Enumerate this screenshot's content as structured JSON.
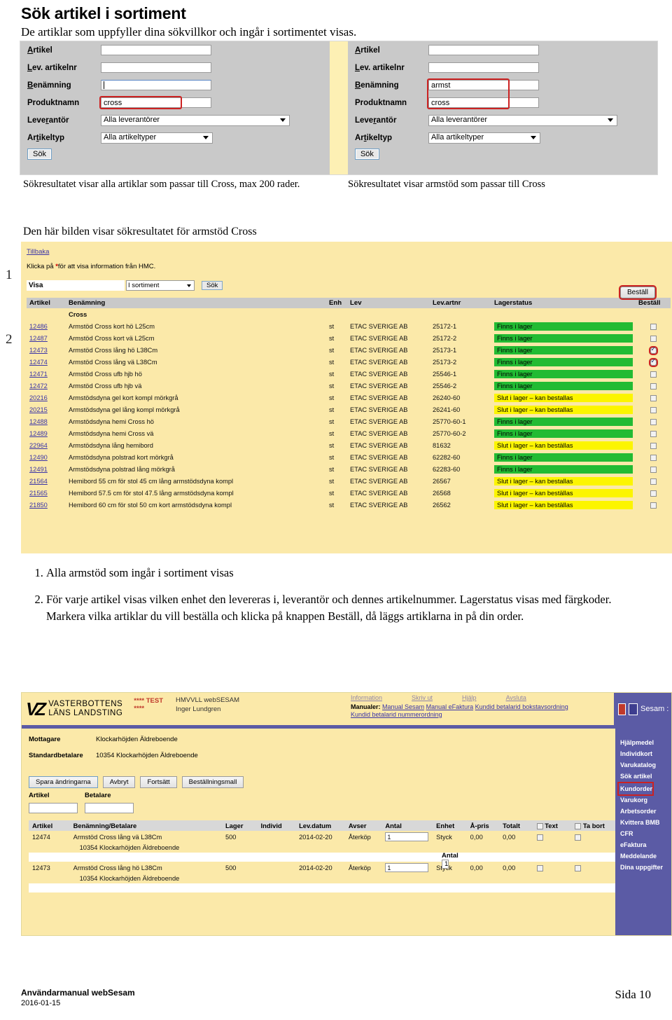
{
  "doc": {
    "title": "Sök artikel i sortiment",
    "subtitle": "De artiklar som uppfyller dina sökvillkor och ingår i sortimentet visas.",
    "intro2": "Den här bilden visar sökresultatet för armstöd Cross",
    "caption_left": "Sökresultatet visar alla artiklar som passar till Cross, max 200 rader.",
    "caption_right": "Sökresultatet visar armstöd som passar till Cross",
    "marker1": "1",
    "marker2": "2"
  },
  "search_form": {
    "labels": {
      "artikel": "Artikel",
      "lev_artikelnr": "Lev. artikelnr",
      "benamning": "Benämning",
      "produktnamn": "Produktnamn",
      "leverantor": "Leverantör",
      "artikeltyp": "Artikeltyp"
    },
    "search_button": "Sök",
    "left": {
      "artikel": "",
      "lev_artikelnr": "",
      "benamning": "",
      "produktnamn": "cross",
      "leverantor": "Alla leverantörer",
      "artikeltyp": "Alla artikeltyper"
    },
    "right": {
      "artikel": "",
      "lev_artikelnr": "",
      "benamning": "armst",
      "produktnamn": "cross",
      "leverantor": "Alla leverantörer",
      "artikeltyp": "Alla artikeltyper"
    }
  },
  "result_screen": {
    "back_link": "Tillbaka",
    "hint_before": "Klicka på ",
    "hint_star": "*",
    "hint_after": "för att visa information från HMC.",
    "visa_label": "Visa",
    "visa_value": "I sortiment",
    "search_button": "Sök",
    "order_button": "Beställ",
    "columns": [
      "Artikel",
      "Benämning",
      "Enh",
      "Lev",
      "Lev.artnr",
      "Lagerstatus",
      "Beställ"
    ],
    "group_label": "Cross",
    "status_colors": {
      "in_stock": "#22bb33",
      "out_of_stock": "#fcf500"
    },
    "rows": [
      {
        "artikel": "12486",
        "benamning": "Armstöd Cross kort hö L25cm",
        "enh": "st",
        "lev": "ETAC SVERIGE AB",
        "levartnr": "25172-1",
        "status": "Finns i lager",
        "status_type": "in_stock",
        "checked": false,
        "highlight": false
      },
      {
        "artikel": "12487",
        "benamning": "Armstöd Cross kort vä L25cm",
        "enh": "st",
        "lev": "ETAC SVERIGE AB",
        "levartnr": "25172-2",
        "status": "Finns i lager",
        "status_type": "in_stock",
        "checked": false,
        "highlight": false
      },
      {
        "artikel": "12473",
        "benamning": "Armstöd Cross lång hö L38Cm",
        "enh": "st",
        "lev": "ETAC SVERIGE AB",
        "levartnr": "25173-1",
        "status": "Finns i lager",
        "status_type": "in_stock",
        "checked": true,
        "highlight": true
      },
      {
        "artikel": "12474",
        "benamning": "Armstöd Cross lång vä L38Cm",
        "enh": "st",
        "lev": "ETAC SVERIGE AB",
        "levartnr": "25173-2",
        "status": "Finns i lager",
        "status_type": "in_stock",
        "checked": true,
        "highlight": true
      },
      {
        "artikel": "12471",
        "benamning": "Armstöd Cross ufb hjb hö",
        "enh": "st",
        "lev": "ETAC SVERIGE AB",
        "levartnr": "25546-1",
        "status": "Finns i lager",
        "status_type": "in_stock",
        "checked": false,
        "highlight": false
      },
      {
        "artikel": "12472",
        "benamning": "Armstöd Cross ufb hjb vä",
        "enh": "st",
        "lev": "ETAC SVERIGE AB",
        "levartnr": "25546-2",
        "status": "Finns i lager",
        "status_type": "in_stock",
        "checked": false,
        "highlight": false
      },
      {
        "artikel": "20216",
        "benamning": "Armstödsdyna gel kort kompl mörkgrå",
        "enh": "st",
        "lev": "ETAC SVERIGE AB",
        "levartnr": "26240-60",
        "status": "Slut i lager – kan bestallas",
        "status_type": "out_of_stock",
        "checked": false,
        "highlight": false
      },
      {
        "artikel": "20215",
        "benamning": "Armstödsdyna gel lång kompl mörkgrå",
        "enh": "st",
        "lev": "ETAC SVERIGE AB",
        "levartnr": "26241-60",
        "status": "Slut i lager – kan bestallas",
        "status_type": "out_of_stock",
        "checked": false,
        "highlight": false
      },
      {
        "artikel": "12488",
        "benamning": "Armstödsdyna hemi Cross hö",
        "enh": "st",
        "lev": "ETAC SVERIGE AB",
        "levartnr": "25770-60-1",
        "status": "Finns i lager",
        "status_type": "in_stock",
        "checked": false,
        "highlight": false
      },
      {
        "artikel": "12489",
        "benamning": "Armstödsdyna hemi Cross vä",
        "enh": "st",
        "lev": "ETAC SVERIGE AB",
        "levartnr": "25770-60-2",
        "status": "Finns i lager",
        "status_type": "in_stock",
        "checked": false,
        "highlight": false
      },
      {
        "artikel": "22964",
        "benamning": "Armstödsdyna lång hemibord",
        "enh": "st",
        "lev": "ETAC SVERIGE AB",
        "levartnr": "81632",
        "status": "Slut i lager – kan beställas",
        "status_type": "out_of_stock",
        "checked": false,
        "highlight": false
      },
      {
        "artikel": "12490",
        "benamning": "Armstödsdyna polstrad kort mörkgrå",
        "enh": "st",
        "lev": "ETAC SVERIGE AB",
        "levartnr": "62282-60",
        "status": "Finns i lager",
        "status_type": "in_stock",
        "checked": false,
        "highlight": false
      },
      {
        "artikel": "12491",
        "benamning": "Armstödsdyna polstrad lång mörkgrå",
        "enh": "st",
        "lev": "ETAC SVERIGE AB",
        "levartnr": "62283-60",
        "status": "Finns i lager",
        "status_type": "in_stock",
        "checked": false,
        "highlight": false
      },
      {
        "artikel": "21564",
        "benamning": "Hemibord 55 cm för stol 45 cm lång armstödsdyna kompl",
        "enh": "st",
        "lev": "ETAC SVERIGE AB",
        "levartnr": "26567",
        "status": "Slut i lager – kan bestallas",
        "status_type": "out_of_stock",
        "checked": false,
        "highlight": false
      },
      {
        "artikel": "21565",
        "benamning": "Hemibord 57.5 cm för stol 47.5 lång armstödsdyna kompl",
        "enh": "st",
        "lev": "ETAC SVERIGE AB",
        "levartnr": "26568",
        "status": "Slut i lager – kan beställas",
        "status_type": "out_of_stock",
        "checked": false,
        "highlight": false
      },
      {
        "artikel": "21850",
        "benamning": "Hemibord 60 cm för stol 50 cm kort armstödsdyna kompl",
        "enh": "st",
        "lev": "ETAC SVERIGE AB",
        "levartnr": "26562",
        "status": "Slut i lager – kan beställas",
        "status_type": "out_of_stock",
        "checked": false,
        "highlight": false
      }
    ]
  },
  "steps": [
    "Alla armstöd som ingår i sortiment visas",
    "För varje artikel visas vilken enhet den levereras i, leverantör och dennes artikelnummer. Lagerstatus visas med färgkoder. Markera vilka artiklar du vill beställa och klicka på knappen Beställ, då läggs artiklarna in på din order."
  ],
  "order_screen": {
    "logo_line1": "VASTERBOTTENS",
    "logo_line2": "LÄNS LANDSTING",
    "test_line1": "**** TEST",
    "test_line2": "****",
    "app_name": "HMVVLL webSESAM",
    "user": "Inger Lundgren",
    "top_links": [
      "Information",
      "Skriv ut",
      "Hjälp",
      "Avsluta"
    ],
    "manual_label": "Manualer:",
    "manual_links": [
      "Manual Sesam",
      "Manual eFaktura",
      "Kundid betalarid bokstavsordning",
      "Kundid betalarid nummerordning"
    ],
    "sesam_label": "Sesam :",
    "mottagare_label": "Mottagare",
    "mottagare_value": "Klockarhöjden Äldreboende",
    "standardbetalare_label": "Standardbetalare",
    "standardbetalare_value": "10354 Klockarhöjden Äldreboende",
    "buttons": [
      "Spara ändringarna",
      "Avbryt",
      "Fortsätt",
      "Beställningsmall"
    ],
    "artikel_label": "Artikel",
    "artikel_value": "",
    "betalare_label": "Betalare",
    "betalare_value": "",
    "antal_label": "Antal",
    "antal_value": "1",
    "sidebar": [
      {
        "label": "Hjälpmedel",
        "active": false
      },
      {
        "label": "Individkort",
        "active": false
      },
      {
        "label": "Varukatalog",
        "active": false
      },
      {
        "label": "Sök artikel",
        "active": false
      },
      {
        "label": "Kundorder",
        "active": true
      },
      {
        "label": "Varukorg",
        "active": false
      },
      {
        "label": "Arbetsorder",
        "active": false
      },
      {
        "label": "Kvittera BMB",
        "active": false
      },
      {
        "label": "CFR",
        "active": false
      },
      {
        "label": "eFaktura",
        "active": false
      },
      {
        "label": "Meddelande",
        "active": false
      },
      {
        "label": "Dina uppgifter",
        "active": false
      }
    ],
    "table_columns": [
      "Artikel",
      "Benämning/Betalare",
      "Lager",
      "Individ",
      "Lev.datum",
      "Avser",
      "Antal",
      "Enhet",
      "Å-pris",
      "Totalt",
      "Text",
      "Ta bort"
    ],
    "table_rows": [
      {
        "artikel": "12474",
        "benamning": "Armstöd Cross lång vä L38Cm",
        "lager": "500",
        "individ": "",
        "levdatum": "2014-02-20",
        "avser": "Återköp",
        "antal": "1",
        "enhet": "Styck",
        "apris": "0,00",
        "totalt": "0,00",
        "text_checked": false,
        "tabort_checked": false,
        "betalare": "10354 Klockarhöjden Äldreboende"
      },
      {
        "artikel": "12473",
        "benamning": "Armstöd Cross lång hö L38Cm",
        "lager": "500",
        "individ": "",
        "levdatum": "2014-02-20",
        "avser": "Återköp",
        "antal": "1",
        "enhet": "Styck",
        "apris": "0,00",
        "totalt": "0,00",
        "text_checked": false,
        "tabort_checked": false,
        "betalare": "10354 Klockarhöjden Äldreboende"
      }
    ]
  },
  "footer": {
    "manual": "Användarmanual webSesam",
    "date": "2016-01-15",
    "page": "Sida 10"
  }
}
